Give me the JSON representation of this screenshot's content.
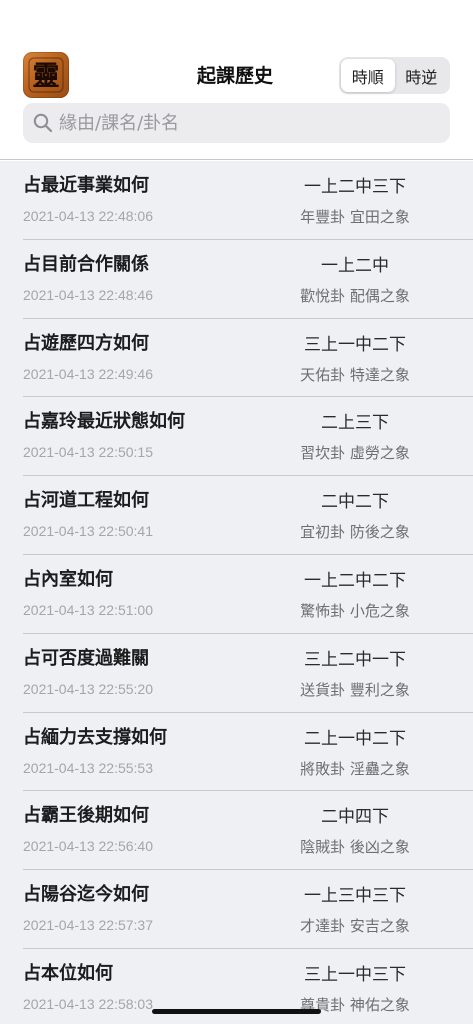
{
  "header": {
    "title": "起課歷史",
    "app_icon_glyph": "靈",
    "sort_options": [
      "時順",
      "時逆"
    ],
    "sort_selected": "時順"
  },
  "search": {
    "placeholder": "緣由/課名/卦名",
    "value": ""
  },
  "records": [
    {
      "title": "占最近事業如何",
      "time": "2021-04-13 22:48:06",
      "lines": "一上二中三下",
      "gua": "年豐卦 宜田之象"
    },
    {
      "title": "占目前合作關係",
      "time": "2021-04-13 22:48:46",
      "lines": "一上二中",
      "gua": "歡悅卦 配偶之象"
    },
    {
      "title": "占遊歷四方如何",
      "time": "2021-04-13 22:49:46",
      "lines": "三上一中二下",
      "gua": "天佑卦 特達之象"
    },
    {
      "title": "占嘉玲最近狀態如何",
      "time": "2021-04-13 22:50:15",
      "lines": "二上三下",
      "gua": "習坎卦 虛勞之象"
    },
    {
      "title": "占河道工程如何",
      "time": "2021-04-13 22:50:41",
      "lines": "二中二下",
      "gua": "宜初卦 防後之象"
    },
    {
      "title": "占內室如何",
      "time": "2021-04-13 22:51:00",
      "lines": "一上二中二下",
      "gua": "驚怖卦 小危之象"
    },
    {
      "title": "占可否度過難關",
      "time": "2021-04-13 22:55:20",
      "lines": "三上二中一下",
      "gua": "送貨卦 豐利之象"
    },
    {
      "title": "占緬力去支撐如何",
      "time": "2021-04-13 22:55:53",
      "lines": "二上一中二下",
      "gua": "將敗卦 淫蠱之象"
    },
    {
      "title": "占霸王後期如何",
      "time": "2021-04-13 22:56:40",
      "lines": "二中四下",
      "gua": "陰賊卦 後凶之象"
    },
    {
      "title": "占陽谷迄今如何",
      "time": "2021-04-13 22:57:37",
      "lines": "一上三中三下",
      "gua": "才達卦 安吉之象"
    },
    {
      "title": "占本位如何",
      "time": "2021-04-13 22:58:03",
      "lines": "三上一中三下",
      "gua": "尊貴卦 神佑之象"
    }
  ],
  "colors": {
    "list_background": "#eef0f3",
    "icon_wood": "#c06a25"
  }
}
